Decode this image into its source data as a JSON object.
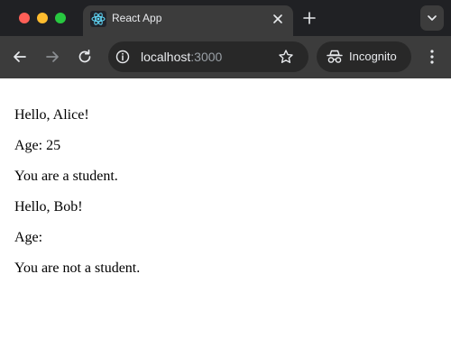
{
  "browser": {
    "tab": {
      "title": "React App",
      "favicon": "react-logo-icon"
    },
    "address_bar": {
      "host": "localhost",
      "port": ":3000"
    },
    "incognito_label": "Incognito",
    "colors": {
      "chrome_dark": "#202124",
      "toolbar": "#3c3c3c",
      "omnibox": "#282828"
    }
  },
  "page": {
    "lines": [
      "Hello, Alice!",
      "Age: 25",
      "You are a student.",
      "Hello, Bob!",
      "Age:",
      "You are not a student."
    ]
  }
}
